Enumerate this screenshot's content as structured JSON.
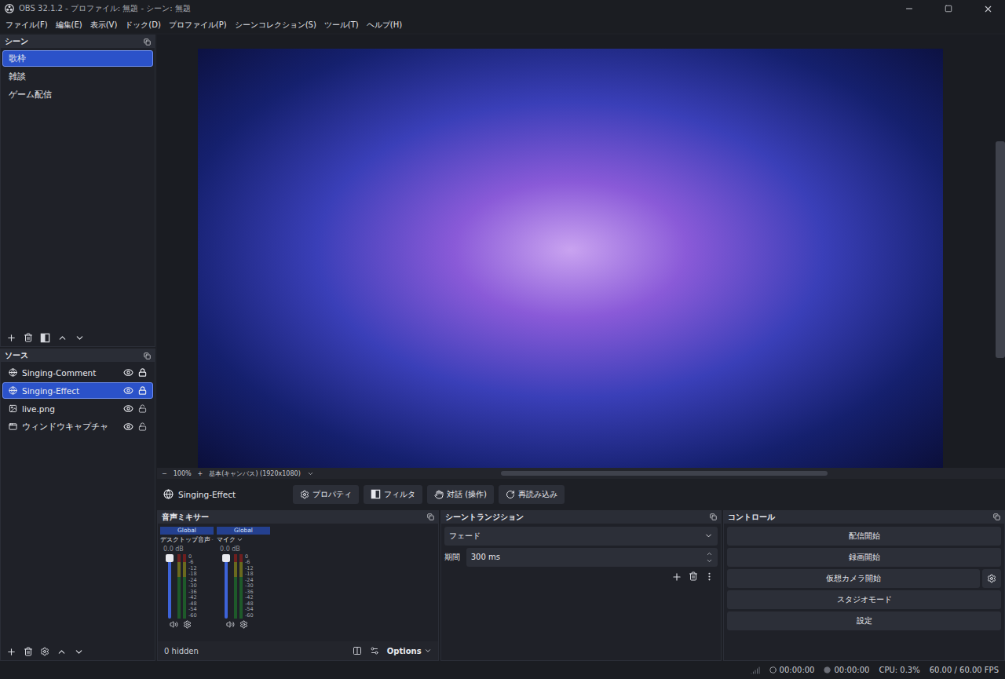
{
  "window": {
    "title": "OBS 32.1.2 - プロファイル: 無題 - シーン: 無題"
  },
  "menu": [
    "ファイル(F)",
    "編集(E)",
    "表示(V)",
    "ドック(D)",
    "プロファイル(P)",
    "シーンコレクション(S)",
    "ツール(T)",
    "ヘルプ(H)"
  ],
  "scenes": {
    "title": "シーン",
    "items": [
      {
        "label": "歌枠",
        "selected": true
      },
      {
        "label": "雑談",
        "selected": false
      },
      {
        "label": "ゲーム配信",
        "selected": false
      }
    ]
  },
  "sources": {
    "title": "ソース",
    "items": [
      {
        "label": "Singing-Comment",
        "kind": "browser",
        "visible": true,
        "locked": true,
        "selected": false
      },
      {
        "label": "Singing-Effect",
        "kind": "browser",
        "visible": true,
        "locked": true,
        "selected": true
      },
      {
        "label": "live.png",
        "kind": "image",
        "visible": true,
        "locked": false,
        "selected": false
      },
      {
        "label": "ウィンドウキャプチャ",
        "kind": "window",
        "visible": true,
        "locked": false,
        "selected": false
      }
    ]
  },
  "preview": {
    "zoom_out": "−",
    "zoom": "100%",
    "zoom_in": "+",
    "canvas": "基本(キャンバス) (1920x1080)"
  },
  "source_toolbar": {
    "source": "Singing-Effect",
    "buttons": [
      {
        "label": "プロパティ",
        "kind": "properties"
      },
      {
        "label": "フィルタ",
        "kind": "filters"
      },
      {
        "label": "対話 (操作)",
        "kind": "interact"
      },
      {
        "label": "再読み込み",
        "kind": "refresh"
      }
    ]
  },
  "mixer": {
    "title": "音声ミキサー",
    "channels": [
      {
        "scope": "Global",
        "name": "デスクトップ音声",
        "reading": "0.0 dB",
        "fader_level": 1,
        "meter_level": 0,
        "muted": false
      },
      {
        "scope": "Global",
        "name": "マイク",
        "reading": "0.0 dB",
        "fader_level": 1,
        "meter_level": 0,
        "muted": false
      }
    ],
    "scale": [
      "0",
      "-6",
      "-12",
      "-18",
      "-24",
      "-30",
      "-36",
      "-42",
      "-48",
      "-54",
      "-60"
    ],
    "hidden": "0 hidden",
    "options": "Options"
  },
  "transitions": {
    "title": "シーントランジション",
    "transition": "フェード",
    "duration_label": "期間",
    "duration": "300 ms"
  },
  "controls": {
    "title": "コントロール",
    "buttons": [
      "配信開始",
      "録画開始",
      "仮想カメラ開始",
      "スタジオモード",
      "設定"
    ]
  },
  "status": {
    "stream_time": "00:00:00",
    "record_time": "00:00:00",
    "cpu": "CPU: 0.3%",
    "fps": "60.00 / 60.00 FPS"
  }
}
